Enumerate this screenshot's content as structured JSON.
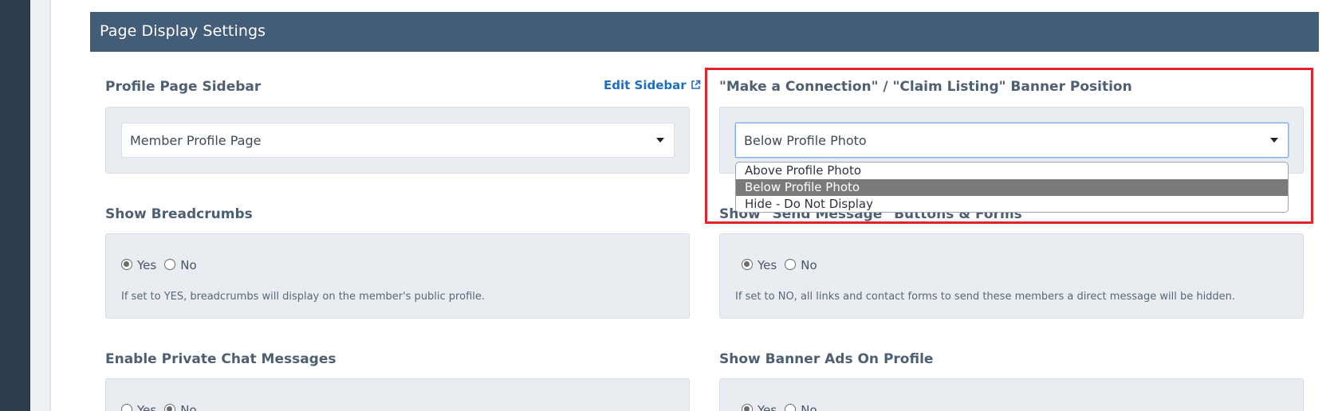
{
  "panel": {
    "title": "Page Display Settings"
  },
  "sidebar_field": {
    "label": "Profile Page Sidebar",
    "edit_link": "Edit Sidebar",
    "value": "Member Profile Page"
  },
  "banner_field": {
    "label": "\"Make a Connection\" / \"Claim Listing\" Banner Position",
    "value": "Below Profile Photo",
    "options": [
      "Above Profile Photo",
      "Below Profile Photo",
      "Hide - Do Not Display"
    ],
    "selected_option": "Below Profile Photo"
  },
  "breadcrumbs_field": {
    "label": "Show Breadcrumbs",
    "yes": "Yes",
    "no": "No",
    "selected": "Yes",
    "help": "If set to YES, breadcrumbs will display on the member's public profile."
  },
  "send_message_field": {
    "label": "Show \"Send Message\" Buttons & Forms",
    "yes": "Yes",
    "no": "No",
    "selected": "Yes",
    "help": "If set to NO, all links and contact forms to send these members a direct message will be hidden."
  },
  "private_chat_field": {
    "label": "Enable Private Chat Messages",
    "yes": "Yes",
    "no": "No",
    "selected": "No"
  },
  "banner_ads_field": {
    "label": "Show Banner Ads On Profile",
    "yes": "Yes",
    "no": "No",
    "selected": "Yes"
  },
  "icons": {
    "external_link": "external-link-icon",
    "caret": "caret-down-icon"
  },
  "colors": {
    "header_bg": "#435d78",
    "highlight": "#e0242a",
    "link": "#1f6fc0",
    "selected_option_bg": "#7a7a7a"
  }
}
